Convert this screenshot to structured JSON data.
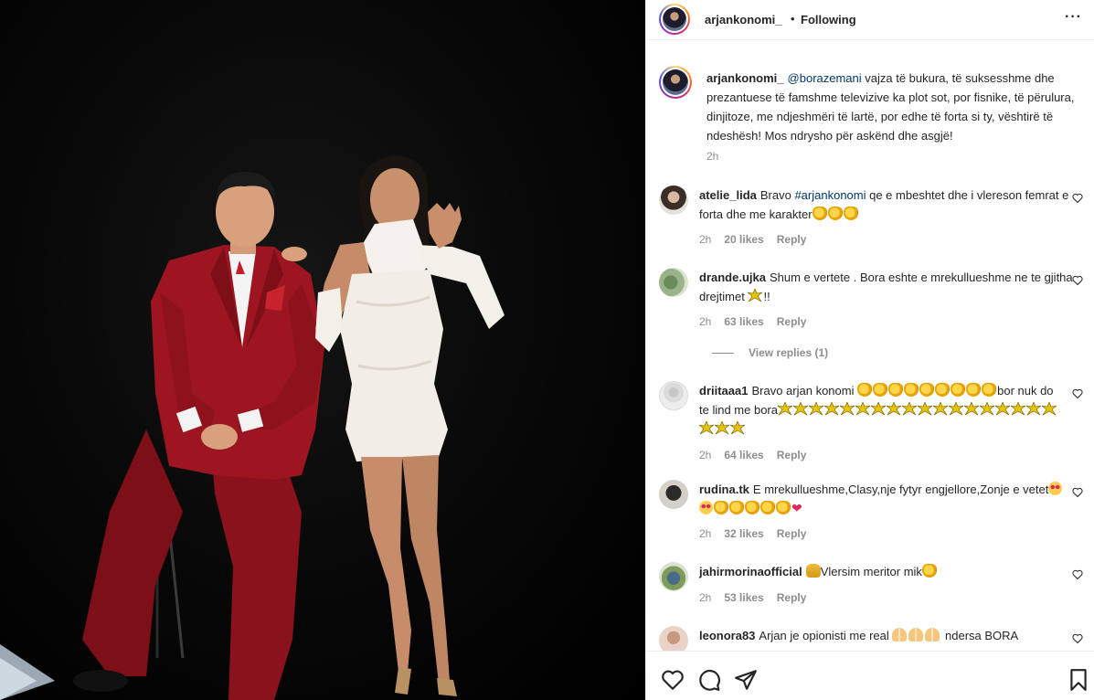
{
  "post": {
    "author": "arjankonomi_",
    "separator": "•",
    "follow_status": "Following",
    "more_label": "···",
    "caption": {
      "username": "arjankonomi_",
      "mention": "@borazemani",
      "text": " vajza të bukura, të suksesshme dhe prezantuese të famshme televizive ka plot sot, por fisnike, të përulura, dinjitoze, me ndjeshmëri të lartë, por edhe të forta si ty, vështirë të ndeshësh! Mos ndrysho për askënd dhe asgjë!",
      "time": "2h"
    }
  },
  "comments": [
    {
      "username": "atelie_lida",
      "text_before": "Bravo ",
      "hashtag": "#arjankonomi",
      "text_after": " qe e mbeshtet dhe i vlereson femrat e forta dhe me karakter",
      "emoji": "👏👏👏",
      "time": "2h",
      "likes": "20 likes",
      "reply": "Reply"
    },
    {
      "username": "drande.ujka",
      "text": "Shum e vertete . Bora eshte e mrekullueshme ne te gjitha drejtimet ",
      "emoji": "💥",
      "text_end": "!!",
      "time": "2h",
      "likes": "63 likes",
      "reply": "Reply",
      "view_replies": "View replies (1)"
    },
    {
      "username": "driitaaa1",
      "text": "Bravo arjan konomi ",
      "emoji": "👏👏👏👏👏👏👏👏👏💥💥💥💥💥💥💥💥💥💥💥💥💥💥💥💥💥💥💥💥💥",
      "text_mid": "bor nuk do te lind me bora",
      "time": "2h",
      "likes": "64 likes",
      "reply": "Reply"
    },
    {
      "username": "rudina.tk",
      "text": "E mrekullueshme,Clasy,nje fytyr engjellore,Zonje e vetet",
      "emoji": "😍😍👏👏👏👏👏❤",
      "time": "2h",
      "likes": "32 likes",
      "reply": "Reply"
    },
    {
      "username": "jahirmorinaofficial",
      "text": "Vlersim meritor mik",
      "emoji": "🙌👏",
      "time": "2h",
      "likes": "53 likes",
      "reply": "Reply"
    },
    {
      "username": "leonora83",
      "text": "Arjan je opionisti me real ",
      "emoji": "🙏🙏🙏",
      "text_after": " ndersa BORA"
    }
  ],
  "actions": {
    "like_icon": "heart-outline-icon",
    "comment_icon": "comment-bubble-icon",
    "share_icon": "paper-plane-icon",
    "save_icon": "bookmark-icon"
  }
}
